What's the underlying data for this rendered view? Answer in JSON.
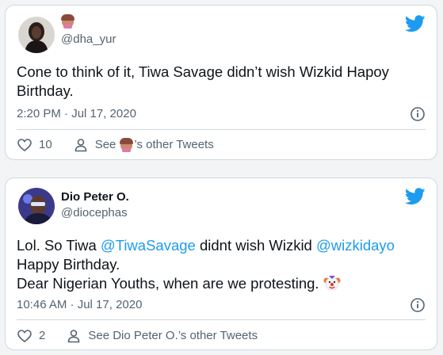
{
  "tweets": [
    {
      "name": "",
      "handle": "@dha_yur",
      "text": "Cone to think of it, Tiwa Savage didn’t wish Wizkid Hapoy Birthday.",
      "timestamp": "2:20 PM · Jul 17, 2020",
      "likes": "10",
      "other_tweets_prefix": "See",
      "other_tweets_suffix": "’s other Tweets"
    },
    {
      "name": "Dio Peter O.",
      "handle": "@diocephas",
      "text_parts": {
        "p1": "Lol. So Tiwa ",
        "mention1": "@TiwaSavage",
        "p2": " didnt wish Wizkid ",
        "mention2": "@wizkidayo",
        "line2": "Happy Birthday.",
        "line3": "Dear Nigerian Youths, when are we protesting. "
      },
      "timestamp": "10:46 AM · Jul 17, 2020",
      "likes": "2",
      "other_tweets": "See Dio Peter O.’s other Tweets"
    }
  ],
  "icons": [
    "twitter-bird-icon",
    "info-icon",
    "heart-icon",
    "person-icon",
    "woman-tipping-hand-emoji",
    "clown-face-emoji"
  ],
  "colors": {
    "accent": "#1d9bf0",
    "text": "#0f1419",
    "secondary": "#536471",
    "border": "#cfd9de",
    "background": "#f2f4f6"
  }
}
